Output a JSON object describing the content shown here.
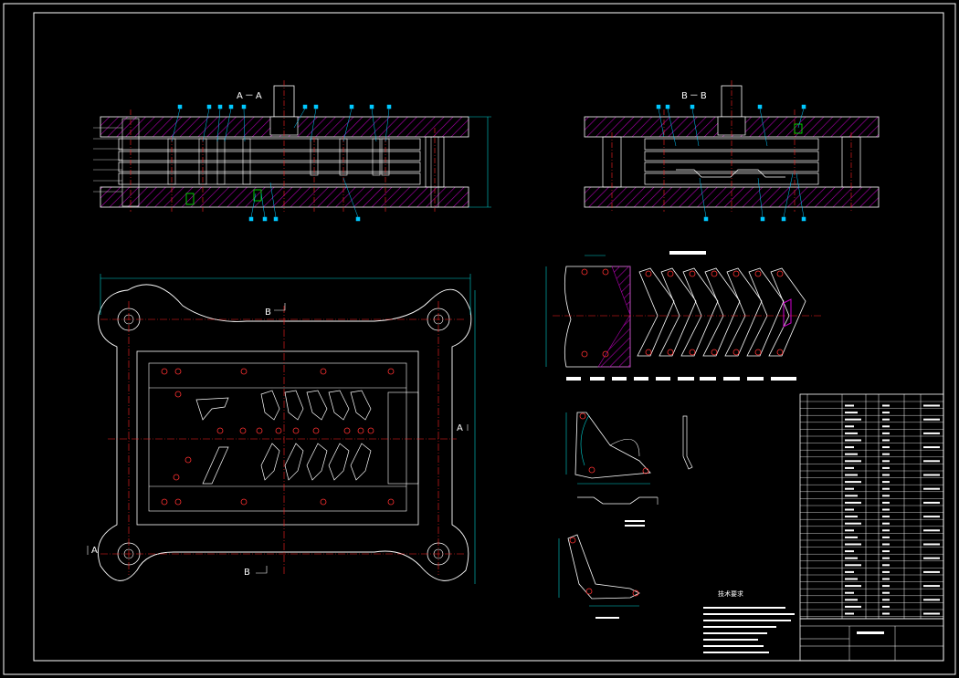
{
  "drawing": {
    "type": "CAD progressive die assembly drawing",
    "colors": {
      "background": "#000000",
      "frame": "#ffffff",
      "hatch": "#c000c0",
      "center_lines": "#ff2020",
      "dimensions": "#00d0d0",
      "callout": "#00c8ff",
      "part_outline": "#ffffff",
      "highlight": "#00ff00"
    }
  },
  "views": {
    "section_aa_title": "A－A",
    "section_bb_title": "B－B",
    "plan_marker_b_top": "B",
    "plan_marker_b_bottom": "B",
    "plan_marker_a_left": "A",
    "plan_marker_a_right": "A"
  },
  "notes": {
    "title": "技术要求"
  }
}
